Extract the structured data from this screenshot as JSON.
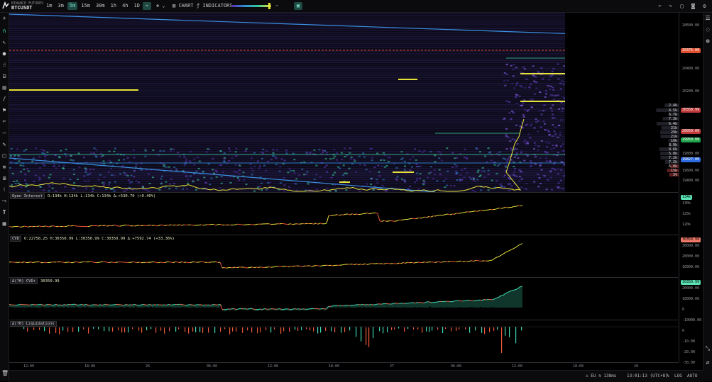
{
  "header": {
    "exchange": "BINANCE FUTURES",
    "symbol": "BTCUSDT",
    "timeframes": [
      "1m",
      "3m",
      "5m",
      "15m",
      "30m",
      "1h",
      "4h",
      "1D"
    ],
    "active_timeframe": "5m",
    "chart_label": "CHART",
    "indicators_label": "INDICATORS"
  },
  "colors": {
    "accent": "#1f4a44",
    "up": "#3fd6b0",
    "down": "#f0583a",
    "heatmap_yellow": "#e8e33a",
    "heatmap_purple": "#3b2a6e",
    "trendline": "#3a8fe0"
  },
  "price_axis": {
    "ticks": [
      "20600.00",
      "20400.00",
      "20200.00",
      "19800.00",
      "19600.00",
      "19400.00"
    ],
    "pills": [
      {
        "text": "20375.00",
        "color": "#e0502f"
      },
      {
        "text": "30350.99",
        "color": "#c03a3a"
      },
      {
        "text": "20050.00",
        "color": "#c03a3a"
      },
      {
        "text": "19950.00",
        "color": "#1fa34a"
      },
      {
        "text": "19827.00",
        "color": "#2d6be0"
      }
    ]
  },
  "dom_sizes": [
    "2.4k",
    "4.5k",
    "6.7k",
    "7.3k",
    "6.4k",
    "21k",
    "29k",
    "21k",
    "10k",
    "8.9k",
    "9.6k",
    "5.8k",
    "7.2k",
    "7.2k",
    "6.0k",
    "15k",
    "3%"
  ],
  "panes": {
    "open_interest": {
      "name": "Open Interest",
      "values": "O:134k H:134k L:134k C:134k Δ:+530.70 (+0.40%)",
      "ticks": [
        "130k",
        "125k",
        "120k"
      ],
      "last_pill": "134k"
    },
    "cvd": {
      "name": "CVD",
      "values": "O:22758.25 H:30350.99 L:30350.99 C:30350.99 Δ:+7592.74 (+33.36%)",
      "ticks": [
        "30000.00",
        "20000.00",
        "10000.00"
      ],
      "last_pill": "30350.99"
    },
    "delta_cvd": {
      "name": "Δ(?θ) CVD+",
      "values": "30350.99",
      "ticks": [
        "20000.00",
        "10000.00",
        "0",
        "-10000.00"
      ],
      "last_pill": "30350.99"
    },
    "liquidations": {
      "name": "Δ(?θ) Liquidations",
      "ticks": [
        "0",
        "-10.00",
        "-20.00",
        "-30.00"
      ]
    }
  },
  "time_axis": [
    "12:00",
    "18:00",
    "26",
    "06:00",
    "12:00",
    "18:00",
    "27",
    "06:00",
    "12:00",
    "18:00",
    "28"
  ],
  "status": {
    "region": "EU",
    "latency": "138ms",
    "clock": "13:01:13 (UTC+8)",
    "percent": "%",
    "log": "LOG",
    "auto": "AUTO"
  }
}
